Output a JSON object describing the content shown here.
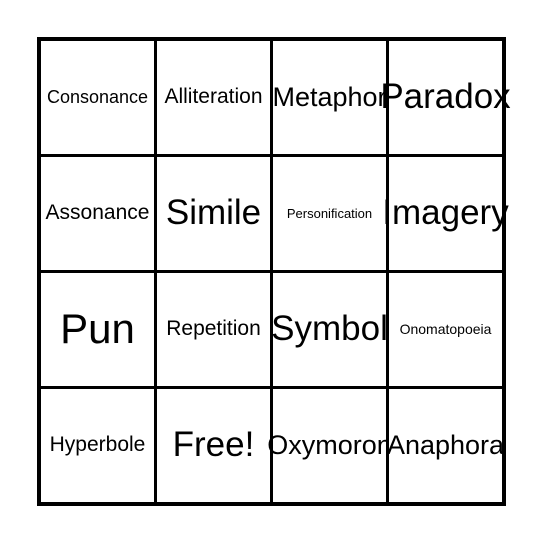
{
  "card": {
    "type": "bingo-card",
    "columns": 4,
    "rows": 4,
    "background_color": "#ffffff",
    "border_color": "#000000",
    "text_color": "#000000",
    "free_space_label": "Free!",
    "cells": [
      [
        {
          "label": "Consonance",
          "size": "sm",
          "free": false
        },
        {
          "label": "Alliteration",
          "size": "md",
          "free": false
        },
        {
          "label": "Metaphor",
          "size": "lg",
          "free": false
        },
        {
          "label": "Paradox",
          "size": "xl",
          "free": false
        }
      ],
      [
        {
          "label": "Assonance",
          "size": "md",
          "free": false
        },
        {
          "label": "Simile",
          "size": "xl",
          "free": false
        },
        {
          "label": "Personification",
          "size": "xxs",
          "free": false
        },
        {
          "label": "Imagery",
          "size": "xl",
          "free": false
        }
      ],
      [
        {
          "label": "Pun",
          "size": "xxl",
          "free": false
        },
        {
          "label": "Repetition",
          "size": "md",
          "free": false
        },
        {
          "label": "Symbol",
          "size": "xl",
          "free": false
        },
        {
          "label": "Onomatopoeia",
          "size": "xs",
          "free": false
        }
      ],
      [
        {
          "label": "Hyperbole",
          "size": "md",
          "free": false
        },
        {
          "label": "Free!",
          "size": "xl",
          "free": true
        },
        {
          "label": "Oxymoron",
          "size": "lg",
          "free": false
        },
        {
          "label": "Anaphora",
          "size": "lg",
          "free": false
        }
      ]
    ]
  }
}
